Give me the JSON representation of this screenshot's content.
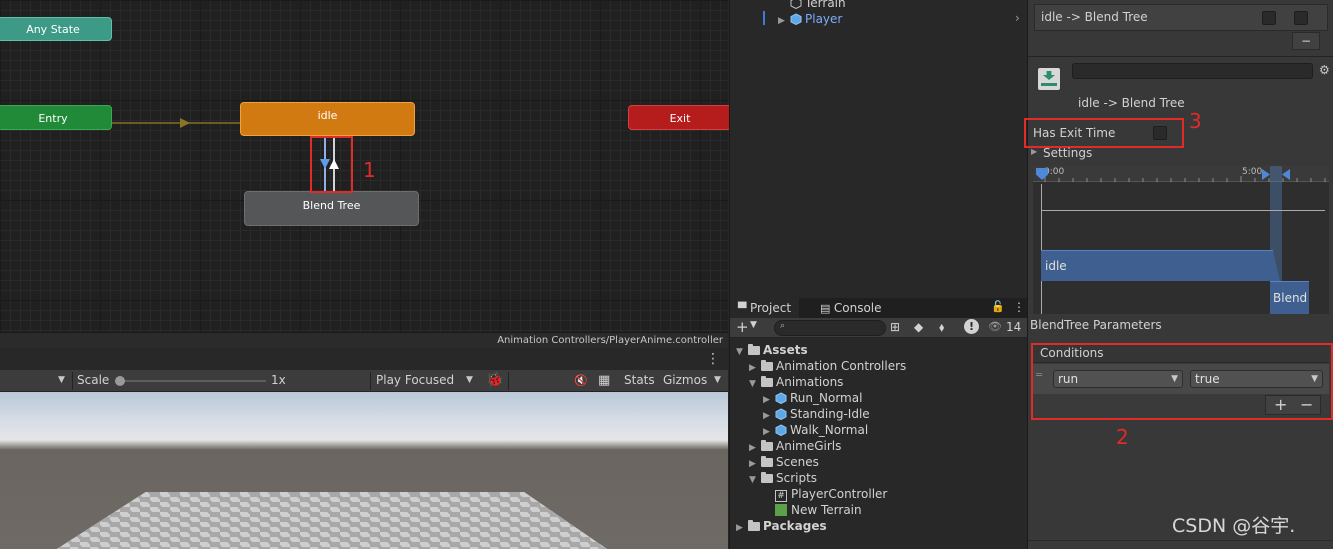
{
  "animator": {
    "nodes": {
      "any_state": "Any State",
      "entry": "Entry",
      "idle": "idle",
      "exit": "Exit",
      "blend_tree": "Blend Tree"
    },
    "footer_path": "Animation Controllers/PlayerAnime.controller"
  },
  "annotations": {
    "one": "1",
    "two": "2",
    "three": "3"
  },
  "game_view": {
    "scale_label": "Scale",
    "scale_value": "1x",
    "play_mode": "Play Focused",
    "stats": "Stats",
    "gizmos": "Gizmos",
    "more": "⋮"
  },
  "hierarchy": {
    "items": [
      "Terrain",
      "Player"
    ]
  },
  "project": {
    "tabs": [
      "Project",
      "Console"
    ],
    "hidden_count": "14",
    "tree": {
      "assets": "Assets",
      "animation_controllers": "Animation Controllers",
      "animations": "Animations",
      "run_normal": "Run_Normal",
      "standing_idle": "Standing-Idle",
      "walk_normal": "Walk_Normal",
      "anime_girls": "AnimeGirls",
      "scenes": "Scenes",
      "scripts": "Scripts",
      "player_controller": "PlayerController",
      "new_terrain": "New Terrain",
      "packages": "Packages"
    }
  },
  "inspector": {
    "transition_list_item": "idle -> Blend Tree",
    "minus": "−",
    "transition_title": "idle -> Blend Tree",
    "has_exit_time": "Has Exit Time",
    "settings": "Settings",
    "timeline": {
      "start_label": "0:00",
      "end_label": "5:00",
      "clip_a": "idle",
      "clip_b": "Blend"
    },
    "blendtree_params": "BlendTree Parameters",
    "conditions_header": "Conditions",
    "condition": {
      "parameter": "run",
      "value": "true"
    },
    "plus": "+",
    "minus_small": "−"
  },
  "watermark": "CSDN @谷宇."
}
